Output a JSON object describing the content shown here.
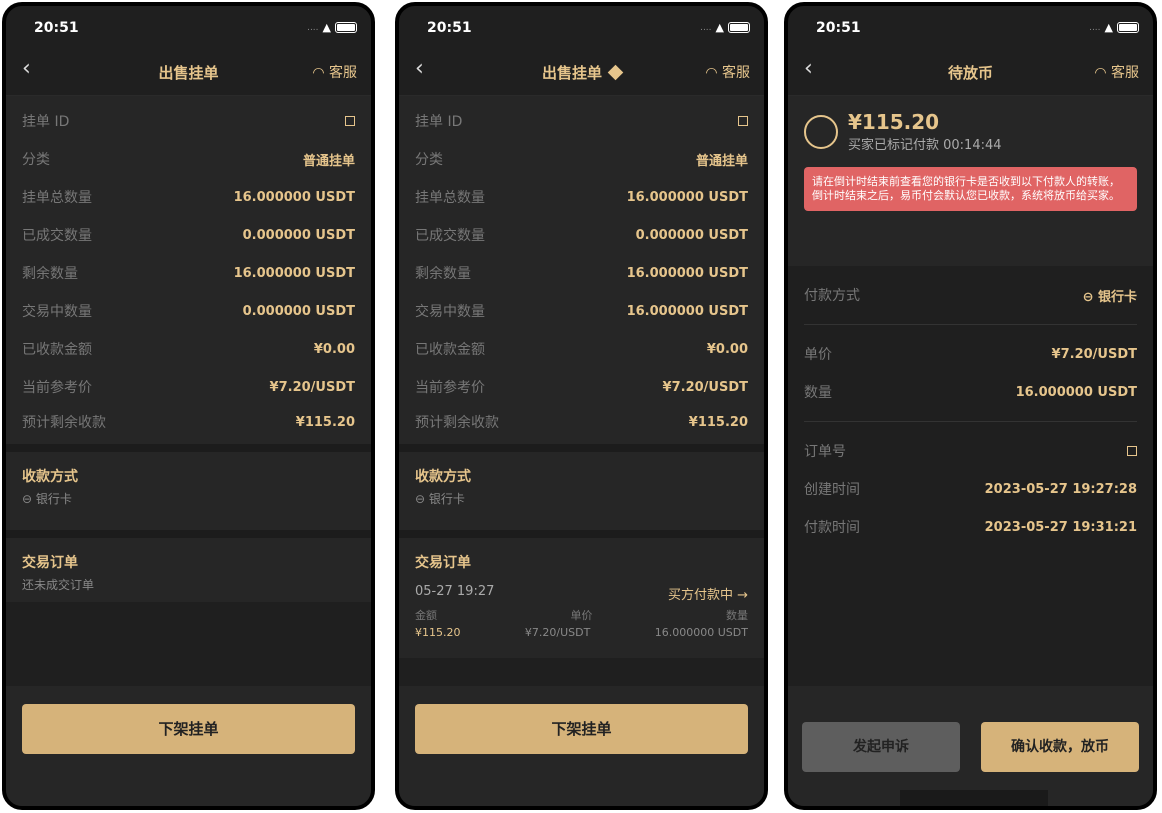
{
  "status_time": "20:51",
  "screens": [
    {
      "title": "出售挂单",
      "support": "客服",
      "rows": [
        [
          "挂单 ID",
          ""
        ],
        [
          "分类",
          "普通挂单"
        ],
        [
          "挂单总数量",
          "16.000000 USDT"
        ],
        [
          "已成交数量",
          "0.000000 USDT"
        ],
        [
          "剩余数量",
          "16.000000 USDT"
        ],
        [
          "交易中数量",
          "0.000000 USDT"
        ],
        [
          "已收款金额",
          "¥0.00"
        ],
        [
          "当前参考价",
          "¥7.20/USDT"
        ],
        [
          "预计剩余收款",
          "¥115.20"
        ]
      ],
      "payment_title": "收款方式",
      "payment_item": "银行卡",
      "orders_title": "交易订单",
      "orders_empty": "还未成交订单",
      "button": "下架挂单"
    },
    {
      "title": "出售挂单",
      "support": "客服",
      "rows": [
        [
          "挂单 ID",
          ""
        ],
        [
          "分类",
          "普通挂单"
        ],
        [
          "挂单总数量",
          "16.000000 USDT"
        ],
        [
          "已成交数量",
          "0.000000 USDT"
        ],
        [
          "剩余数量",
          "16.000000 USDT"
        ],
        [
          "交易中数量",
          "16.000000 USDT"
        ],
        [
          "已收款金额",
          "¥0.00"
        ],
        [
          "当前参考价",
          "¥7.20/USDT"
        ],
        [
          "预计剩余收款",
          "¥115.20"
        ]
      ],
      "payment_title": "收款方式",
      "payment_item": "银行卡",
      "orders_title": "交易订单",
      "order": {
        "date": "05-27 19:27",
        "status": "买方付款中 →",
        "labels": [
          "金额",
          "单价",
          "数量"
        ],
        "values": [
          "¥115.20",
          "¥7.20/USDT",
          "16.000000 USDT"
        ]
      },
      "button": "下架挂单"
    },
    {
      "title": "待放币",
      "support": "客服",
      "amount": "¥115.20",
      "marked": "买家已标记付款 00:14:44",
      "warning": "请在倒计时结束前查看您的银行卡是否收到以下付款人的转账，倒计时结束之后，易币付会默认您已收款，系统将放币给买家。",
      "pay_label": "付款方式",
      "pay_value": "银行卡",
      "price_label": "单价",
      "price_value": "¥7.20/USDT",
      "qty_label": "数量",
      "qty_value": "16.000000 USDT",
      "order_label": "订单号",
      "created_label": "创建时间",
      "created_value": "2023-05-27 19:27:28",
      "paid_label": "付款时间",
      "paid_value": "2023-05-27 19:31:21",
      "appeal": "发起申诉",
      "confirm": "确认收款，放币"
    }
  ]
}
